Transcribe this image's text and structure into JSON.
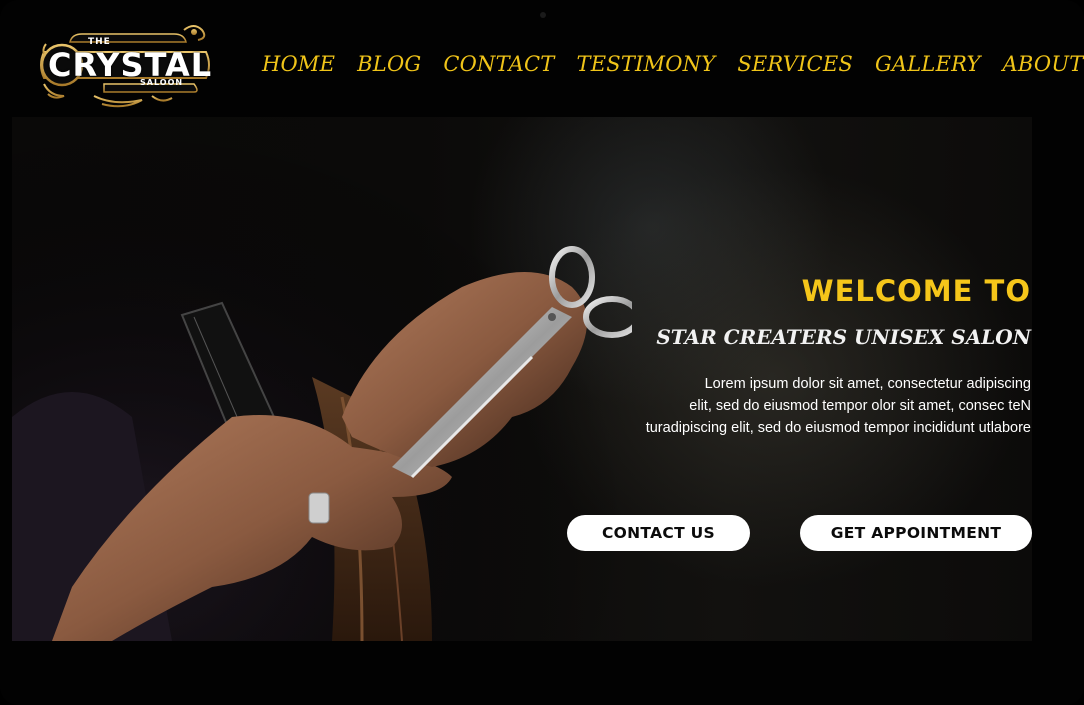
{
  "brand": {
    "the": "THE",
    "name": "CRYSTAL",
    "tagline": "SALOON",
    "accent": "#f0c419"
  },
  "nav": {
    "items": [
      {
        "label": "HOME"
      },
      {
        "label": "BLOG"
      },
      {
        "label": "CONTACT"
      },
      {
        "label": "TESTIMONY"
      },
      {
        "label": "SERVICES"
      },
      {
        "label": "GALLERY"
      },
      {
        "label": "ABOUT"
      }
    ]
  },
  "hero": {
    "heading": "WELCOME TO",
    "subheading": "STAR CREATERS UNISEX SALON",
    "body_lines": [
      "Lorem ipsum dolor sit amet, consectetur adipiscing",
      "elit, sed do eiusmod tempor olor sit amet, consec teN",
      "turadipiscing elit, sed do eiusmod tempor incididunt utlabore"
    ],
    "primary_button": "CONTACT US",
    "secondary_button": "GET APPOINTMENT",
    "image_icon": "hairdresser-scissors-comb-photo"
  }
}
